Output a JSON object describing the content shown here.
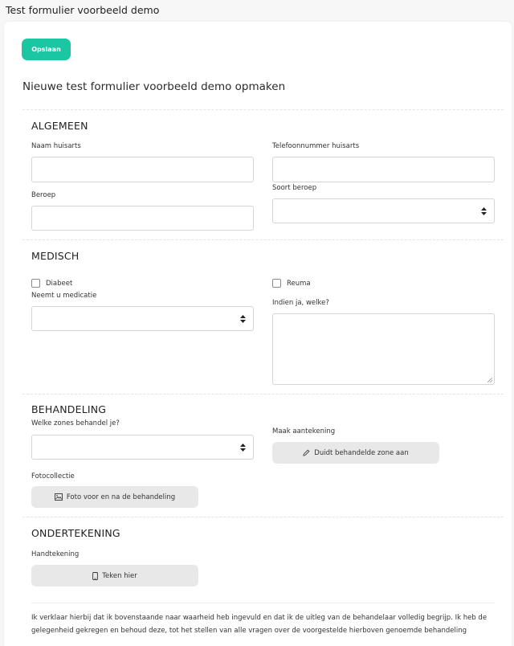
{
  "page": {
    "title": "Test formulier voorbeeld demo"
  },
  "toolbar": {
    "save_label": "Opslaan"
  },
  "form": {
    "heading": "Nieuwe test formulier voorbeeld demo opmaken"
  },
  "sections": {
    "algemeen": {
      "title": "ALGEMEEN",
      "naam_huisarts": {
        "label": "Naam huisarts",
        "value": ""
      },
      "telefoon_huisarts": {
        "label": "Telefoonnummer huisarts",
        "value": ""
      },
      "beroep": {
        "label": "Beroep",
        "value": ""
      },
      "soort_beroep": {
        "label": "Soort beroep",
        "value": ""
      }
    },
    "medisch": {
      "title": "MEDISCH",
      "diabeet": {
        "label": "Diabeet",
        "checked": false
      },
      "reuma": {
        "label": "Reuma",
        "checked": false
      },
      "medicatie": {
        "label": "Neemt u medicatie",
        "value": ""
      },
      "welke": {
        "label": "Indien ja, welke?",
        "value": ""
      }
    },
    "behandeling": {
      "title": "BEHANDELING",
      "zones": {
        "label": "Welke zones behandel je?",
        "value": ""
      },
      "aantekening": {
        "label": "Maak aantekening",
        "button": "Duidt behandelde zone aan"
      },
      "fotocollectie": {
        "label": "Fotocollectie",
        "button": "Foto voor en na de behandeling"
      }
    },
    "ondertekening": {
      "title": "ONDERTEKENING",
      "handtekening": {
        "label": "Handtekening",
        "button": "Teken hier"
      }
    }
  },
  "declaration": "Ik verklaar hierbij dat ik bovenstaande naar waarheid heb ingevuld en dat ik de uitleg van de behandelaar volledig begrijp. Ik heb de gelegenheid gekregen en behoud deze, tot het stellen van alle vragen over de voorgestelde hierboven genoemde behandeling",
  "colors": {
    "accent": "#1bc6a3",
    "button_gray": "#e8e8e8",
    "border": "#d5d5d5"
  },
  "icons": {
    "aantekening": "pencil-icon",
    "fotocollectie": "image-icon",
    "handtekening": "phone-icon"
  }
}
